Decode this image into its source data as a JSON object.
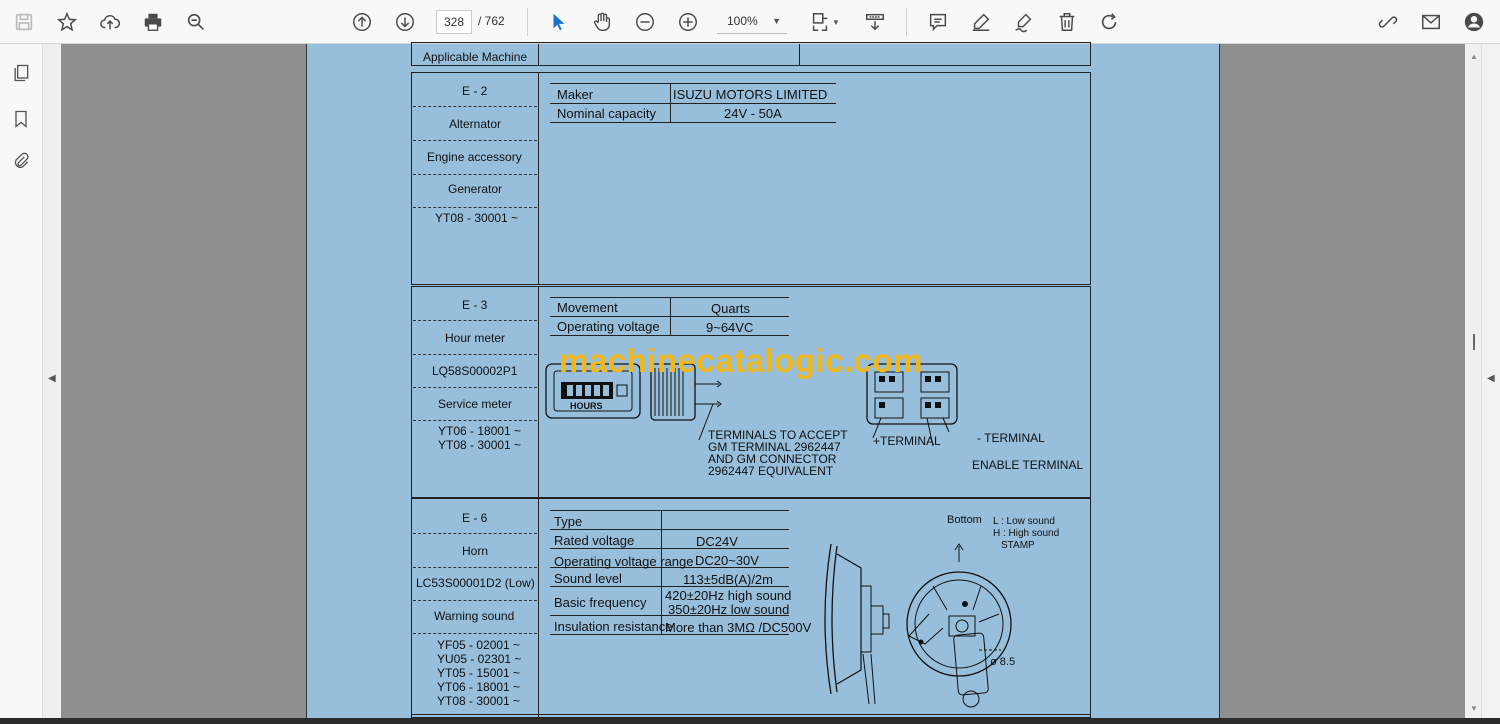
{
  "toolbar": {
    "current_page": "328",
    "total_pages": "/ 762",
    "zoom": "100%"
  },
  "document": {
    "applicable_header_fragment": "Applicable Machine",
    "e2": {
      "code": "E - 2",
      "name": "Alternator",
      "category": "Engine accessory",
      "type": "Generator",
      "serial": "YT08 - 30001 ~",
      "specs": [
        {
          "label": "Maker",
          "value": "ISUZU MOTORS LIMITED"
        },
        {
          "label": "Nominal capacity",
          "value": "24V - 50A"
        }
      ]
    },
    "e3": {
      "code": "E - 3",
      "name": "Hour meter",
      "part": "LQ58S00002P1",
      "type": "Service meter",
      "serial_1": "YT06 - 18001 ~",
      "serial_2": "YT08 - 30001 ~",
      "specs": [
        {
          "label": "Movement",
          "value": "Quarts"
        },
        {
          "label": "Operating voltage",
          "value": "9~64VC"
        }
      ],
      "display_label": "HOURS",
      "note_1": "TERMINALS TO ACCEPT",
      "note_2": "GM TERMINAL 2962447",
      "note_3": "AND GM CONNECTOR",
      "note_4": "2962447 EQUIVALENT",
      "plus_terminal": "+TERMINAL",
      "minus_terminal": "- TERMINAL",
      "enable_terminal": "ENABLE TERMINAL"
    },
    "e6": {
      "code": "E - 6",
      "name": "Horn",
      "part": "LC53S00001D2 (Low)",
      "type": "Warning sound",
      "serials": [
        "YF05 - 02001 ~",
        "YU05 - 02301 ~",
        "YT05 - 15001 ~",
        "YT06 - 18001 ~",
        "YT08 - 30001 ~"
      ],
      "specs": [
        {
          "label": "Type",
          "value": ""
        },
        {
          "label": "Rated voltage",
          "value": "DC24V"
        },
        {
          "label": "Operating voltage range",
          "value": "DC20~30V"
        },
        {
          "label": "Sound level",
          "value": "113±5dB(A)/2m"
        },
        {
          "label": "Basic frequency",
          "value_1": "420±20Hz high sound",
          "value_2": "350±20Hz low sound"
        },
        {
          "label": "Insulation resistance",
          "value": "More than 3MΩ /DC500V"
        }
      ],
      "bottom_label": "Bottom",
      "low_label": "L : Low sound",
      "high_label": "H : High sound",
      "stamp_label": "STAMP",
      "dia_label": "ø 8.5"
    }
  },
  "watermark": "machinecatalogic.com"
}
